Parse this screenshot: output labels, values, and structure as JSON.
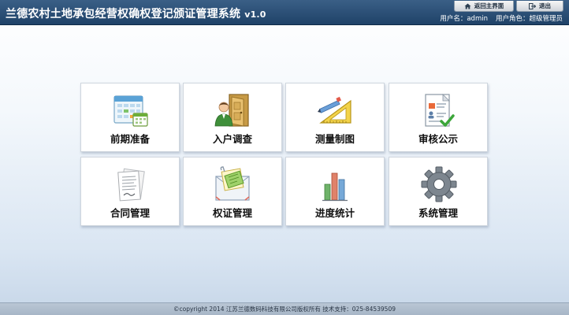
{
  "header": {
    "title": "兰德农村土地承包经营权确权登记颁证管理系统",
    "version": "v1.0",
    "home_button": "返回主界面",
    "logout_button": "退出",
    "username_label": "用户名：admin",
    "role_label": "用户角色：超级管理员"
  },
  "modules": [
    {
      "label": "前期准备",
      "icon": "planning-calendar-icon"
    },
    {
      "label": "入户调查",
      "icon": "household-survey-door-icon"
    },
    {
      "label": "测量制图",
      "icon": "survey-mapping-triangle-icon"
    },
    {
      "label": "审核公示",
      "icon": "review-document-check-icon"
    },
    {
      "label": "合同管理",
      "icon": "contract-papers-icon"
    },
    {
      "label": "权证管理",
      "icon": "certificate-envelope-icon"
    },
    {
      "label": "进度统计",
      "icon": "bar-chart-icon"
    },
    {
      "label": "系统管理",
      "icon": "gear-icon"
    }
  ],
  "footer": {
    "text": "©copyright 2014 江苏兰德数码科技有限公司版权所有 技术支持：025-84539509"
  }
}
